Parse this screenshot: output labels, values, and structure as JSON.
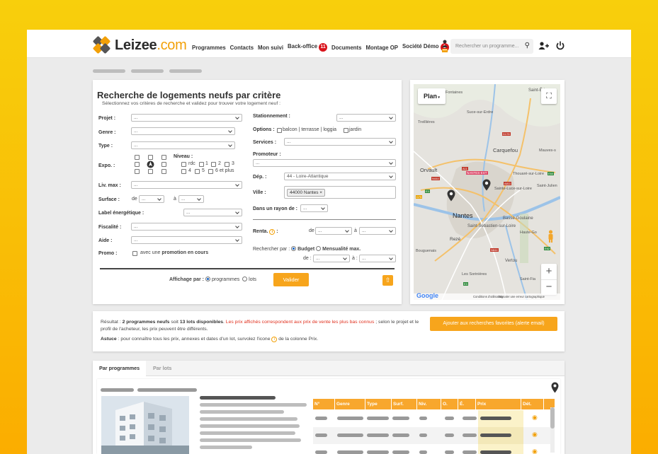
{
  "brand": {
    "name": "Leizee",
    "tld": ".com"
  },
  "nav": {
    "items": [
      {
        "label": "Programmes"
      },
      {
        "label": "Contacts"
      },
      {
        "label": "Mon suivi"
      },
      {
        "label": "Back-office",
        "badge": "11"
      },
      {
        "label": "Documents"
      },
      {
        "label": "Montage OP"
      },
      {
        "label": "Société Démo",
        "badge": "1"
      }
    ],
    "search_placeholder": "Rechercher un programme..."
  },
  "search_form": {
    "title": "Recherche de logements neufs par critère",
    "subtitle": "Sélectionnez vos critères de recherche et validez pour trouver votre logement neuf :",
    "projet": {
      "label": "Projet :",
      "value": "..."
    },
    "genre": {
      "label": "Genre :",
      "value": "..."
    },
    "type": {
      "label": "Type :",
      "value": "..."
    },
    "expo": {
      "label": "Expo. :"
    },
    "niveau": {
      "label": "Niveau :",
      "options": [
        "rdc",
        "1",
        "2",
        "3",
        "4",
        "5",
        "6 et plus"
      ]
    },
    "liv_max": {
      "label": "Liv. max :",
      "value": "..."
    },
    "surface": {
      "label": "Surface :",
      "from": "de",
      "to": "à",
      "from_value": "...",
      "to_value": "..."
    },
    "label_energetique": {
      "label": "Label énergétique :",
      "value": "..."
    },
    "fiscalite": {
      "label": "Fiscalité :",
      "value": "..."
    },
    "aide": {
      "label": "Aide :",
      "value": "..."
    },
    "promo": {
      "label": "Promo :",
      "text_prefix": "avec une",
      "text_bold": "promotion en cours"
    },
    "stationnement": {
      "label": "Stationnement :",
      "value": "..."
    },
    "options": {
      "label": "Options :",
      "items": [
        "balcon | terrasse | loggia",
        "jardin"
      ]
    },
    "services": {
      "label": "Services :",
      "value": "..."
    },
    "promoteur": {
      "label": "Promoteur :",
      "value": "..."
    },
    "dep": {
      "label": "Dép. :",
      "value": "44 - Loire-Atlantique"
    },
    "ville": {
      "label": "Ville :",
      "tag": "44000 Nantes ×"
    },
    "rayon": {
      "label": "Dans un rayon de :",
      "value": "..."
    },
    "renta": {
      "label": "Renta.",
      "from": "de",
      "to": "à",
      "from_value": "...",
      "to_value": "..."
    },
    "rechercher_par": {
      "label": "Rechercher par :",
      "option1": "Budget",
      "option2": "Mensualité max.",
      "from": "de :",
      "to": "à :",
      "from_value": "...",
      "to_value": "..."
    },
    "affichage": {
      "label": "Affichage par :",
      "option1": "programmes",
      "option2": "lots"
    },
    "valider": "Valider"
  },
  "map": {
    "type_label": "Plan",
    "city": "Nantes",
    "places": [
      "Fontaines",
      "Saint-Éd",
      "Suce-sur-Erdre",
      "Treillières",
      "Carquefou",
      "Mauves-s",
      "Orvault",
      "NANTES-EST",
      "Thouaré-sur-Loire",
      "Sainte-Luce-sur-Loire",
      "Saint-Julien",
      "Basse-Goulaine",
      "Saint-Sébastien-sur-Loire",
      "Haute-Go",
      "Rezé",
      "Bouguenais",
      "Vertou",
      "Les Sorinières",
      "Saint-Fia"
    ],
    "roads": [
      "D178",
      "A11",
      "N444",
      "A811",
      "E60",
      "E3",
      "D75",
      "N844",
      "E3",
      "E62"
    ],
    "footer": {
      "google": "Google",
      "data": "Conditions d'utilisation",
      "report": "Signaler une erreur cartographique"
    }
  },
  "results": {
    "prefix": "Résultat :",
    "count_programmes": "2 programmes neufs",
    "mid": "soit",
    "count_lots": "13 lots disponibles",
    "red_note": "Les prix affichés correspondent aux prix de vente les plus bas connus",
    "suffix": "; selon le projet et le profil de l'acheteur, les prix peuvent être différents.",
    "astuce_label": "Astuce",
    "astuce_text": ": pour connaître tous les prix, annexes et dates d'un lot, survolez l'icone",
    "astuce_end": "de la colonne Prix.",
    "save_button": "Ajouter aux recherches favorites (alerte email)"
  },
  "tabs": [
    {
      "label": "Par programmes"
    },
    {
      "label": "Par lots"
    }
  ],
  "table": {
    "headers": [
      "N°",
      "Genre",
      "Type",
      "Surf.",
      "Niv.",
      "O.",
      "É.",
      "Prix",
      "Dét."
    ]
  }
}
